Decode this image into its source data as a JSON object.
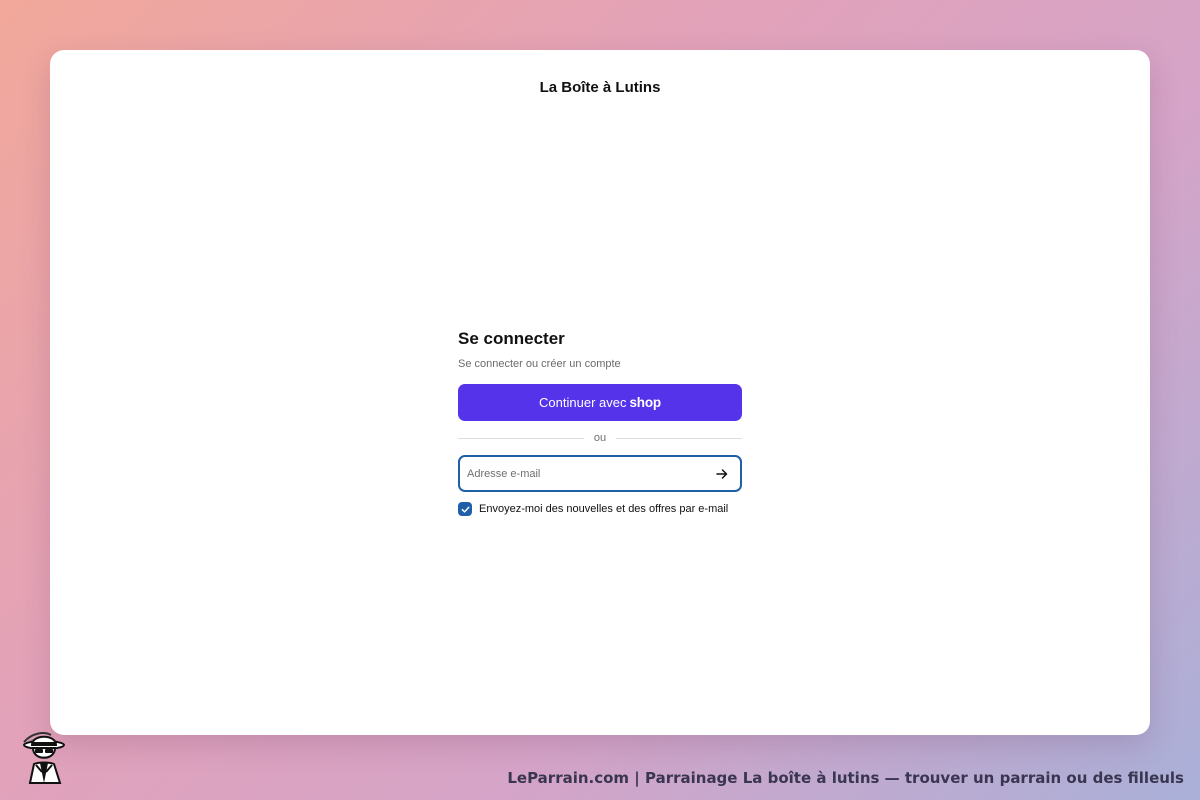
{
  "shop": {
    "name": "La Boîte à Lutins"
  },
  "login": {
    "title": "Se connecter",
    "subtitle": "Se connecter ou créer un compte",
    "shop_button": {
      "prefix": "Continuer avec",
      "brand": "shop"
    },
    "divider": "ou",
    "email": {
      "placeholder": "Adresse e-mail",
      "value": "",
      "submit_icon": "arrow-right-icon"
    },
    "newsletter": {
      "label": "Envoyez-moi des nouvelles et des offres par e-mail",
      "checked": true
    }
  },
  "footer": {
    "text": "LeParrain.com | Parrainage La boîte à lutins — trouver un parrain ou des filleuls",
    "mascot_icon": "godfather-mascot-icon"
  },
  "colors": {
    "shop_button": "#5433eb",
    "focus_border": "#1f5fa8",
    "checkbox": "#1f5fa8"
  }
}
